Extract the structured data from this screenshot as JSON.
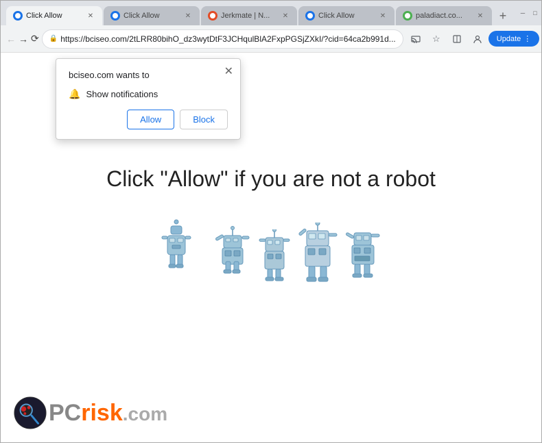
{
  "browser": {
    "tabs": [
      {
        "id": "tab1",
        "label": "Click Allow",
        "active": true,
        "favicon_color": "#1a73e8"
      },
      {
        "id": "tab2",
        "label": "Click Allow",
        "active": false,
        "favicon_color": "#1a73e8"
      },
      {
        "id": "tab3",
        "label": "Jerkmate | N...",
        "active": false,
        "favicon_color": "#e34c26"
      },
      {
        "id": "tab4",
        "label": "Click Allow",
        "active": false,
        "favicon_color": "#1a73e8"
      },
      {
        "id": "tab5",
        "label": "paladiact.co...",
        "active": false,
        "favicon_color": "#4caf50"
      }
    ],
    "address": "https://bciseo.com/2tLRR80bihO_dz3wytDtF3JCHqulBlA2FxpPGSjZXkI/?cid=64ca2b991d...",
    "update_label": "Update"
  },
  "popup": {
    "title": "bciseo.com wants to",
    "notification_text": "Show notifications",
    "allow_label": "Allow",
    "block_label": "Block"
  },
  "page": {
    "main_text": "Click \"Allow\"   if you are not   a robot"
  },
  "logo": {
    "pc_text": "PC",
    "risk_text": "risk",
    "com_text": ".com"
  }
}
